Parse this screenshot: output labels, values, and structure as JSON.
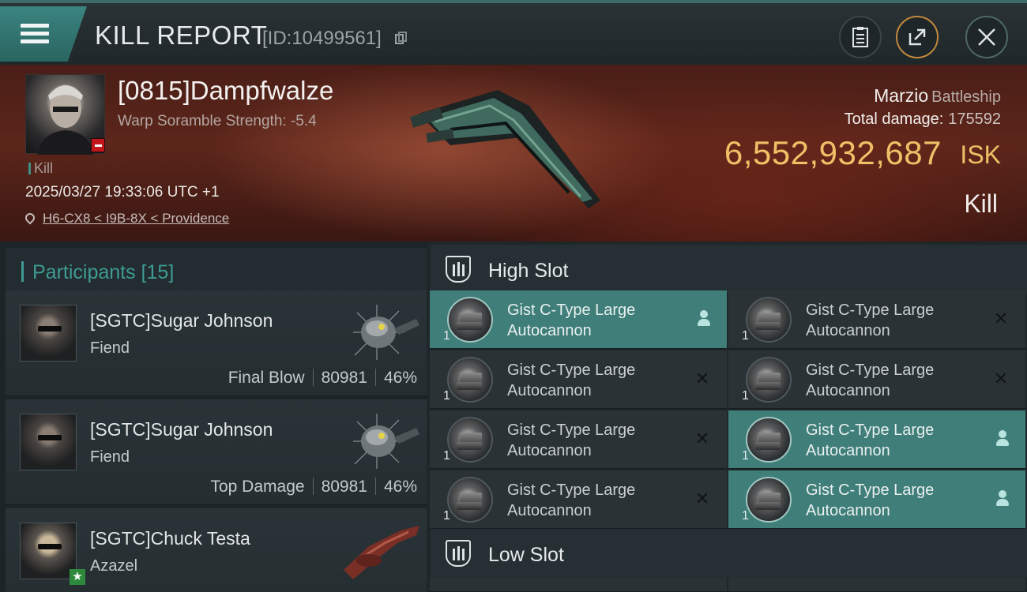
{
  "header": {
    "title": "KILL REPORT",
    "id_text": "[ID:10499561]"
  },
  "victim": {
    "name": "[0815]Dampfwalze",
    "subtitle": "Warp Soramble Strength: -5.4",
    "tag": "Kill",
    "timestamp": "2025/03/27 19:33:06 UTC +1",
    "location": "H6-CX8 < I9B-8X < Providence"
  },
  "ship": {
    "name": "Marzio",
    "class": "Battleship",
    "total_damage_label": "Total damage:",
    "total_damage": "175592",
    "isk_value": "6,552,932,687",
    "isk_unit": "ISK",
    "result": "Kill"
  },
  "participants": {
    "title": "Participants [15]",
    "rows": [
      {
        "name": "[SGTC]Sugar Johnson",
        "ship": "Fiend",
        "role": "Final Blow",
        "damage": "80981",
        "percent": "46%"
      },
      {
        "name": "[SGTC]Sugar Johnson",
        "ship": "Fiend",
        "role": "Top Damage",
        "damage": "80981",
        "percent": "46%"
      },
      {
        "name": "[SGTC]Chuck Testa",
        "ship": "Azazel",
        "role": "",
        "damage": "",
        "percent": ""
      }
    ]
  },
  "fitting": {
    "high_slot_title": "High Slot",
    "low_slot_title": "Low Slot",
    "high_slots": [
      {
        "line1": "Gist C-Type Large",
        "line2": "Autocannon",
        "qty": "1",
        "status": "dropped"
      },
      {
        "line1": "Gist C-Type Large",
        "line2": "Autocannon",
        "qty": "1",
        "status": "destroyed"
      },
      {
        "line1": "Gist C-Type Large",
        "line2": "Autocannon",
        "qty": "1",
        "status": "destroyed"
      },
      {
        "line1": "Gist C-Type Large",
        "line2": "Autocannon",
        "qty": "1",
        "status": "destroyed"
      },
      {
        "line1": "Gist C-Type Large",
        "line2": "Autocannon",
        "qty": "1",
        "status": "destroyed"
      },
      {
        "line1": "Gist C-Type Large",
        "line2": "Autocannon",
        "qty": "1",
        "status": "dropped"
      },
      {
        "line1": "Gist C-Type Large",
        "line2": "Autocannon",
        "qty": "1",
        "status": "destroyed"
      },
      {
        "line1": "Gist C-Type Large",
        "line2": "Autocannon",
        "qty": "1",
        "status": "dropped"
      }
    ]
  },
  "colors": {
    "accent_teal": "#3f9b93",
    "isk_gold": "#f0c067",
    "dropped_bg": "#3f7e79"
  }
}
